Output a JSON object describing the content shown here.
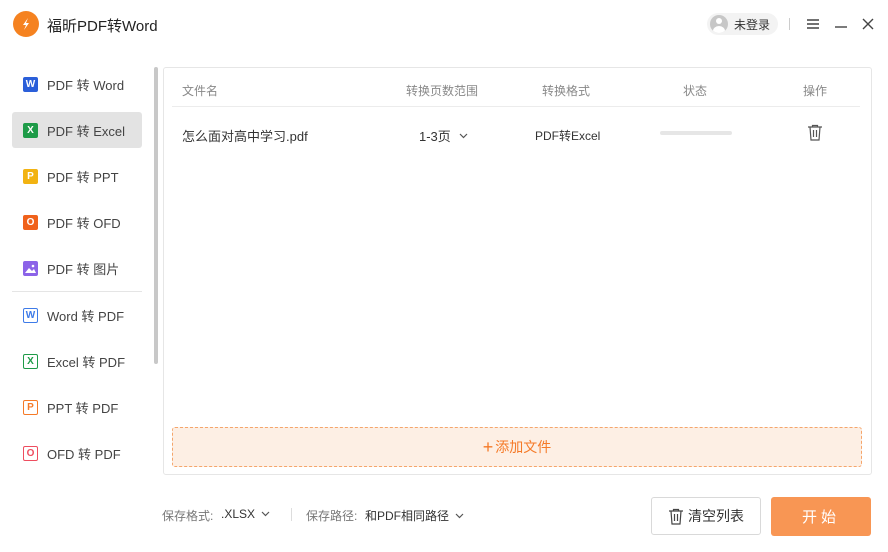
{
  "app": {
    "title": "福昕PDF转Word"
  },
  "user": {
    "label": "未登录"
  },
  "sidebar": {
    "items": [
      {
        "label": "PDF 转 Word",
        "icon": "word-icon",
        "color": "#2b5fd9"
      },
      {
        "label": "PDF 转 Excel",
        "icon": "excel-icon",
        "color": "#1e9b48",
        "active": true
      },
      {
        "label": "PDF 转 PPT",
        "icon": "ppt-icon",
        "color": "#f2b312"
      },
      {
        "label": "PDF 转 OFD",
        "icon": "ofd-icon",
        "color": "#f0611a"
      },
      {
        "label": "PDF 转 图片",
        "icon": "image-icon",
        "color": "#8c63e8"
      },
      {
        "label": "Word 转 PDF",
        "icon": "word-to-pdf-icon",
        "color": "#3e7be8"
      },
      {
        "label": "Excel 转 PDF",
        "icon": "excel-to-pdf-icon",
        "color": "#1e9b48"
      },
      {
        "label": "PPT 转 PDF",
        "icon": "ppt-to-pdf-icon",
        "color": "#f57a28"
      },
      {
        "label": "OFD 转 PDF",
        "icon": "ofd-to-pdf-icon",
        "color": "#ee4d5f"
      }
    ]
  },
  "table": {
    "columns": [
      "文件名",
      "转换页数范围",
      "转换格式",
      "状态",
      "操作"
    ],
    "rows": [
      {
        "filename": "怎么面对高中学习.pdf",
        "range": "1-3页",
        "format": "PDF转Excel",
        "progress": 0
      }
    ]
  },
  "add_file": {
    "label": "添加文件"
  },
  "footer": {
    "format_label": "保存格式:",
    "format_value": ".XLSX",
    "path_label": "保存路径:",
    "path_value": "和PDF相同路径",
    "clear_label": "清空列表",
    "start_label": "开始"
  },
  "colors": {
    "accent": "#f89654",
    "add_zone_bg": "#fdefe4",
    "add_zone_text": "#f57a28"
  }
}
